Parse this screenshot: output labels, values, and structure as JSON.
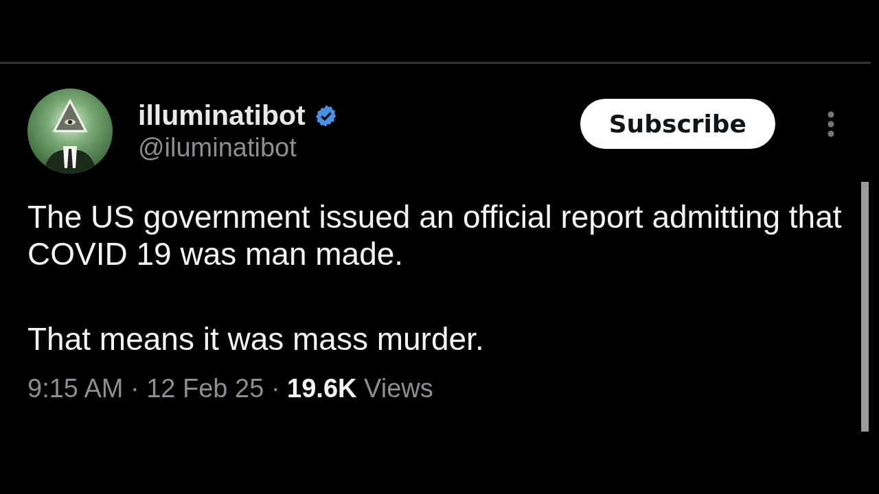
{
  "post": {
    "author": {
      "name": "illuminatibot",
      "verified": true,
      "handle": "@iluminatibot"
    },
    "subscribe_button": "Subscribe",
    "text": [
      "The US government issued an official report admitting that COVID 19 was man made.",
      "That means it was mass murder."
    ],
    "meta": "9:15 AM · 12 Feb 25 · **19.6K** Views"
  }
}
